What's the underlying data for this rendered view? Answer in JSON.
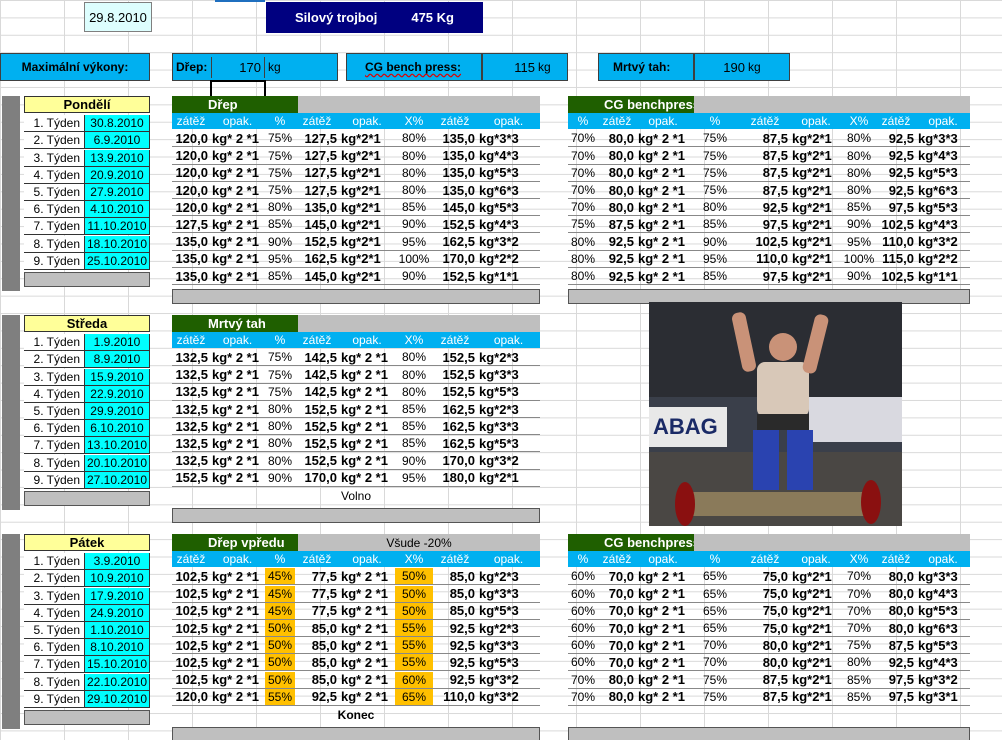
{
  "header": {
    "date": "29.8.2010",
    "title": "Silový trojboj",
    "total": "475 Kg"
  },
  "max": {
    "label": "Maximální výkony:",
    "drep_label": "Dřep:",
    "drep_val": "170",
    "unit": "kg",
    "bench_label": "CG bench press:",
    "bench_val": "115",
    "tah_label": "Mrtvý tah:",
    "tah_val": "190"
  },
  "weeks": [
    "1. Týden",
    "2. Týden",
    "3. Týden",
    "4. Týden",
    "5. Týden",
    "6. Týden",
    "7. Týden",
    "8. Týden",
    "9. Týden"
  ],
  "pondeli": {
    "day": "Pondělí",
    "dates": [
      "30.8.2010",
      "6.9.2010",
      "13.9.2010",
      "20.9.2010",
      "27.9.2010",
      "4.10.2010",
      "11.10.2010",
      "18.10.2010",
      "25.10.2010"
    ],
    "drep": {
      "title": "Dřep",
      "cols": [
        "zátěž",
        "opak.",
        "%",
        "zátěž",
        "opak.",
        "X%",
        "zátěž",
        "opak."
      ],
      "rows": [
        [
          "120,0",
          "kg* 2 *1",
          "75%",
          "127,5",
          "kg*2*1",
          "80%",
          "135,0",
          "kg*3*3"
        ],
        [
          "120,0",
          "kg* 2 *1",
          "75%",
          "127,5",
          "kg*2*1",
          "80%",
          "135,0",
          "kg*4*3"
        ],
        [
          "120,0",
          "kg* 2 *1",
          "75%",
          "127,5",
          "kg*2*1",
          "80%",
          "135,0",
          "kg*5*3"
        ],
        [
          "120,0",
          "kg* 2 *1",
          "75%",
          "127,5",
          "kg*2*1",
          "80%",
          "135,0",
          "kg*6*3"
        ],
        [
          "120,0",
          "kg* 2 *1",
          "80%",
          "135,0",
          "kg*2*1",
          "85%",
          "145,0",
          "kg*5*3"
        ],
        [
          "127,5",
          "kg* 2 *1",
          "85%",
          "145,0",
          "kg*2*1",
          "90%",
          "152,5",
          "kg*4*3"
        ],
        [
          "135,0",
          "kg* 2 *1",
          "90%",
          "152,5",
          "kg*2*1",
          "95%",
          "162,5",
          "kg*3*2"
        ],
        [
          "135,0",
          "kg* 2 *1",
          "95%",
          "162,5",
          "kg*2*1",
          "100%",
          "170,0",
          "kg*2*2"
        ],
        [
          "135,0",
          "kg* 2 *1",
          "85%",
          "145,0",
          "kg*2*1",
          "90%",
          "152,5",
          "kg*1*1"
        ]
      ]
    },
    "bench": {
      "title": "CG benchpress",
      "cols": [
        "%",
        "zátěž",
        "opak.",
        "%",
        "zátěž",
        "opak.",
        "X%",
        "zátěž",
        "opak."
      ],
      "rows": [
        [
          "70%",
          "80,0",
          "kg* 2 *1",
          "75%",
          "87,5",
          "kg*2*1",
          "80%",
          "92,5",
          "kg*3*3"
        ],
        [
          "70%",
          "80,0",
          "kg* 2 *1",
          "75%",
          "87,5",
          "kg*2*1",
          "80%",
          "92,5",
          "kg*4*3"
        ],
        [
          "70%",
          "80,0",
          "kg* 2 *1",
          "75%",
          "87,5",
          "kg*2*1",
          "80%",
          "92,5",
          "kg*5*3"
        ],
        [
          "70%",
          "80,0",
          "kg* 2 *1",
          "75%",
          "87,5",
          "kg*2*1",
          "80%",
          "92,5",
          "kg*6*3"
        ],
        [
          "70%",
          "80,0",
          "kg* 2 *1",
          "80%",
          "92,5",
          "kg*2*1",
          "85%",
          "97,5",
          "kg*5*3"
        ],
        [
          "75%",
          "87,5",
          "kg* 2 *1",
          "85%",
          "97,5",
          "kg*2*1",
          "90%",
          "102,5",
          "kg*4*3"
        ],
        [
          "80%",
          "92,5",
          "kg* 2 *1",
          "90%",
          "102,5",
          "kg*2*1",
          "95%",
          "110,0",
          "kg*3*2"
        ],
        [
          "80%",
          "92,5",
          "kg* 2 *1",
          "95%",
          "110,0",
          "kg*2*1",
          "100%",
          "115,0",
          "kg*2*2"
        ],
        [
          "80%",
          "92,5",
          "kg* 2 *1",
          "85%",
          "97,5",
          "kg*2*1",
          "90%",
          "102,5",
          "kg*1*1"
        ]
      ]
    }
  },
  "streda": {
    "day": "Středa",
    "dates": [
      "1.9.2010",
      "8.9.2010",
      "15.9.2010",
      "22.9.2010",
      "29.9.2010",
      "6.10.2010",
      "13.10.2010",
      "20.10.2010",
      "27.10.2010"
    ],
    "tah": {
      "title": "Mrtvý tah",
      "cols": [
        "zátěž",
        "opak.",
        "%",
        "zátěž",
        "opak.",
        "X%",
        "zátěž",
        "opak."
      ],
      "note": "Volno",
      "rows": [
        [
          "132,5",
          "kg* 2 *1",
          "75%",
          "142,5",
          "kg* 2 *1",
          "80%",
          "152,5",
          "kg*2*3"
        ],
        [
          "132,5",
          "kg* 2 *1",
          "75%",
          "142,5",
          "kg* 2 *1",
          "80%",
          "152,5",
          "kg*3*3"
        ],
        [
          "132,5",
          "kg* 2 *1",
          "75%",
          "142,5",
          "kg* 2 *1",
          "80%",
          "152,5",
          "kg*5*3"
        ],
        [
          "132,5",
          "kg* 2 *1",
          "80%",
          "152,5",
          "kg* 2 *1",
          "85%",
          "162,5",
          "kg*2*3"
        ],
        [
          "132,5",
          "kg* 2 *1",
          "80%",
          "152,5",
          "kg* 2 *1",
          "85%",
          "162,5",
          "kg*3*3"
        ],
        [
          "132,5",
          "kg* 2 *1",
          "80%",
          "152,5",
          "kg* 2 *1",
          "85%",
          "162,5",
          "kg*5*3"
        ],
        [
          "132,5",
          "kg* 2 *1",
          "80%",
          "152,5",
          "kg* 2 *1",
          "90%",
          "170,0",
          "kg*3*2"
        ],
        [
          "152,5",
          "kg* 2 *1",
          "90%",
          "170,0",
          "kg* 2 *1",
          "95%",
          "180,0",
          "kg*2*1"
        ]
      ]
    }
  },
  "patek": {
    "day": "Pátek",
    "dates": [
      "3.9.2010",
      "10.9.2010",
      "17.9.2010",
      "24.9.2010",
      "1.10.2010",
      "8.10.2010",
      "15.10.2010",
      "22.10.2010",
      "29.10.2010"
    ],
    "drepv": {
      "title": "Dřep vpředu",
      "subtitle": "Všude -20%",
      "note": "Konec",
      "cols": [
        "zátěž",
        "opak.",
        "%",
        "zátěž",
        "opak.",
        "X%",
        "zátěž",
        "opak."
      ],
      "rows": [
        [
          "102,5",
          "kg* 2 *1",
          "45%",
          "77,5",
          "kg* 2 *1",
          "50%",
          "85,0",
          "kg*2*3"
        ],
        [
          "102,5",
          "kg* 2 *1",
          "45%",
          "77,5",
          "kg* 2 *1",
          "50%",
          "85,0",
          "kg*3*3"
        ],
        [
          "102,5",
          "kg* 2 *1",
          "45%",
          "77,5",
          "kg* 2 *1",
          "50%",
          "85,0",
          "kg*5*3"
        ],
        [
          "102,5",
          "kg* 2 *1",
          "50%",
          "85,0",
          "kg* 2 *1",
          "55%",
          "92,5",
          "kg*2*3"
        ],
        [
          "102,5",
          "kg* 2 *1",
          "50%",
          "85,0",
          "kg* 2 *1",
          "55%",
          "92,5",
          "kg*3*3"
        ],
        [
          "102,5",
          "kg* 2 *1",
          "50%",
          "85,0",
          "kg* 2 *1",
          "55%",
          "92,5",
          "kg*5*3"
        ],
        [
          "102,5",
          "kg* 2 *1",
          "50%",
          "85,0",
          "kg* 2 *1",
          "60%",
          "92,5",
          "kg*3*2"
        ],
        [
          "120,0",
          "kg* 2 *1",
          "55%",
          "92,5",
          "kg* 2 *1",
          "65%",
          "110,0",
          "kg*3*2"
        ]
      ]
    },
    "bench": {
      "title": "CG benchpress",
      "cols": [
        "%",
        "zátěž",
        "opak.",
        "%",
        "zátěž",
        "opak.",
        "X%",
        "zátěž",
        "opak."
      ],
      "rows": [
        [
          "60%",
          "70,0",
          "kg* 2 *1",
          "65%",
          "75,0",
          "kg*2*1",
          "70%",
          "80,0",
          "kg*3*3"
        ],
        [
          "60%",
          "70,0",
          "kg* 2 *1",
          "65%",
          "75,0",
          "kg*2*1",
          "70%",
          "80,0",
          "kg*4*3"
        ],
        [
          "60%",
          "70,0",
          "kg* 2 *1",
          "65%",
          "75,0",
          "kg*2*1",
          "70%",
          "80,0",
          "kg*5*3"
        ],
        [
          "60%",
          "70,0",
          "kg* 2 *1",
          "65%",
          "75,0",
          "kg*2*1",
          "70%",
          "80,0",
          "kg*6*3"
        ],
        [
          "60%",
          "70,0",
          "kg* 2 *1",
          "70%",
          "80,0",
          "kg*2*1",
          "75%",
          "87,5",
          "kg*5*3"
        ],
        [
          "60%",
          "70,0",
          "kg* 2 *1",
          "70%",
          "80,0",
          "kg*2*1",
          "80%",
          "92,5",
          "kg*4*3"
        ],
        [
          "70%",
          "80,0",
          "kg* 2 *1",
          "75%",
          "87,5",
          "kg*2*1",
          "85%",
          "97,5",
          "kg*3*2"
        ],
        [
          "70%",
          "80,0",
          "kg* 2 *1",
          "75%",
          "87,5",
          "kg*2*1",
          "85%",
          "97,5",
          "kg*3*1"
        ]
      ]
    }
  },
  "photo": {
    "icon": "strongman-photo"
  }
}
